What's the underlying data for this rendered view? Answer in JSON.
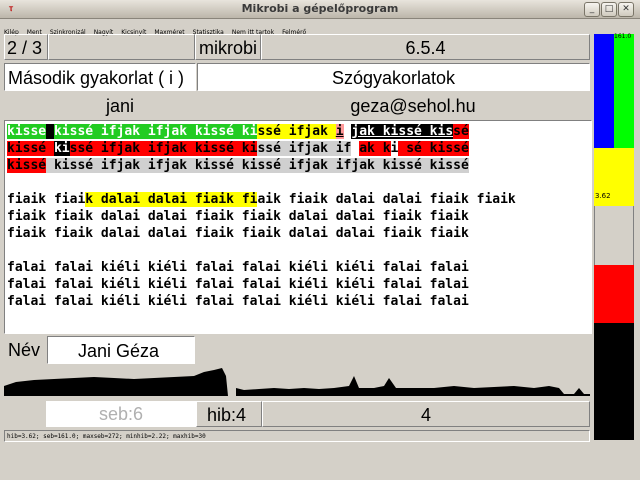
{
  "window": {
    "title": "Mikrobi a gépelőprogram",
    "app_icon": "tk-feather-icon",
    "buttons": {
      "minimize": "_",
      "maximize": "□",
      "close": "✕"
    }
  },
  "menu": [
    "Kilép",
    "Ment",
    "Szinkronizál",
    "Nagyít",
    "Kicsinyít",
    "Maxméret",
    "Statisztika",
    "Nem itt tartok",
    "Felmérő"
  ],
  "header": {
    "counter": "2 / 3",
    "empty_cell": "",
    "program": "mikrobi",
    "version": "6.5.4",
    "lesson": "Második gyakorlat ( i )",
    "lesson_type": "Szógyakorlatok",
    "user": "jani",
    "email": "geza@sehol.hu"
  },
  "practice_rows": [
    {
      "segs": [
        [
          "kisse",
          "g"
        ],
        [
          " ",
          "k"
        ],
        [
          "kissé ifjak ifjak kissé ki",
          "g"
        ],
        [
          "ssé ifjak ",
          "y"
        ],
        [
          "i",
          "p u"
        ],
        [
          " ",
          "n"
        ],
        [
          "jak kissé kis",
          "k u"
        ],
        [
          "sé",
          "r"
        ]
      ]
    },
    {
      "segs": [
        [
          "kissé ",
          "r"
        ],
        [
          "ki",
          "k"
        ],
        [
          "ssé ifjak ifjak kissé ki",
          "r"
        ],
        [
          "ssé ifjak if",
          "gt"
        ],
        [
          " ",
          "w"
        ],
        [
          "ak k",
          "r"
        ],
        [
          "i",
          "w"
        ],
        [
          " ",
          "r"
        ],
        [
          "sé kissé",
          "r"
        ]
      ]
    },
    {
      "segs": [
        [
          "kissé",
          "r"
        ],
        [
          " kissé ifjak ifjak kissé kissé ifjak ifjak kissé kissé",
          "gt"
        ]
      ]
    },
    {
      "segs": [
        [
          "",
          "n"
        ]
      ]
    },
    {
      "segs": [
        [
          "fiaik fiai",
          "n"
        ],
        [
          "k dalai dalai fiaik fi",
          "y"
        ],
        [
          "aik fiaik dalai dalai fiaik fiaik",
          "n"
        ]
      ]
    },
    {
      "segs": [
        [
          "fiaik fiaik dalai dalai fiaik fiaik dalai dalai fiaik fiaik",
          "n"
        ]
      ]
    },
    {
      "segs": [
        [
          "fiaik fiaik dalai dalai fiaik fiaik dalai dalai fiaik fiaik",
          "n"
        ]
      ]
    },
    {
      "segs": [
        [
          "",
          "n"
        ]
      ]
    },
    {
      "segs": [
        [
          "falai falai kiéli kiéli falai falai kiéli kiéli falai falai",
          "n"
        ]
      ]
    },
    {
      "segs": [
        [
          "falai falai kiéli kiéli falai falai kiéli kiéli falai falai",
          "n"
        ]
      ]
    },
    {
      "segs": [
        [
          "falai falai kiéli kiéli falai falai kiéli kiéli falai falai",
          "n"
        ]
      ]
    }
  ],
  "name_row": {
    "label": "Név",
    "value": "Jani Géza"
  },
  "stats_row": {
    "errors_cell": "seb:6",
    "mistakes": "hib:4",
    "count": "4"
  },
  "sidebar": {
    "top_value": "161.0",
    "mid_value": "3.62"
  },
  "status_text": "hib=3.62; seb=161.0; maxseb=272; minhib=2.22; maxhib=30"
}
